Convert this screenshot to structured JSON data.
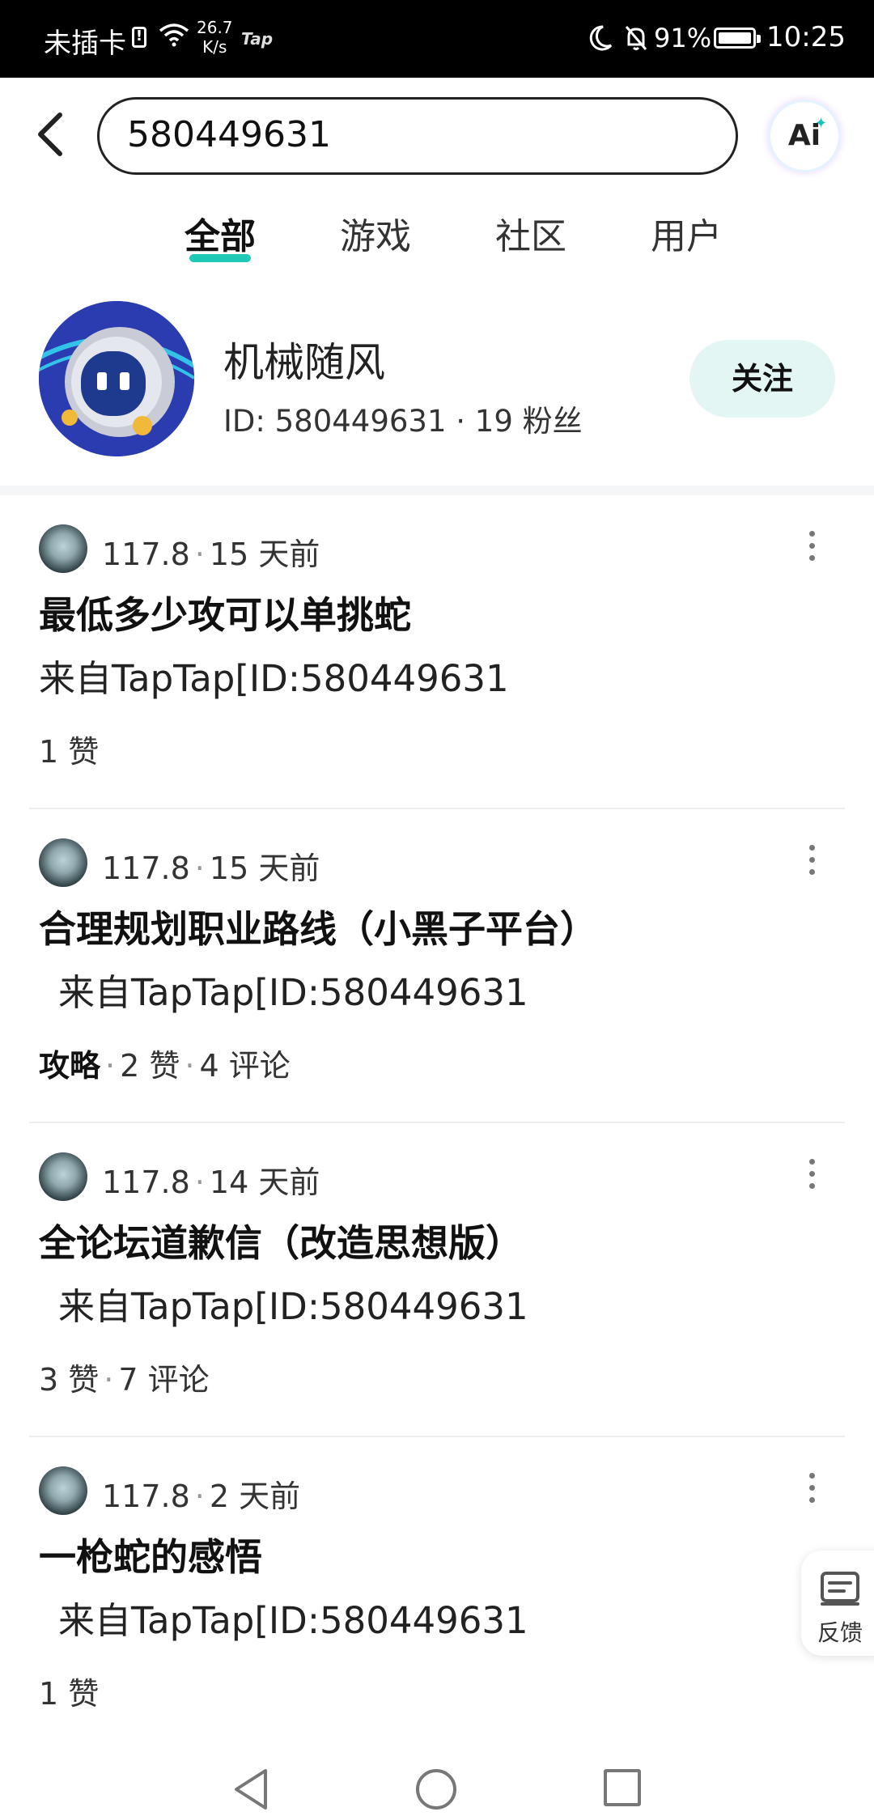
{
  "status_bar": {
    "carrier": "未插卡",
    "sim_alert": "!",
    "net_speed_value": "26.7",
    "net_speed_unit": "K/s",
    "app_badge": "Tap",
    "battery": "91%",
    "battery_level": 0.91,
    "time": "10:25"
  },
  "search": {
    "query": "580449631",
    "ai_label": "Ai"
  },
  "tabs": [
    {
      "label": "全部",
      "active": true
    },
    {
      "label": "游戏",
      "active": false
    },
    {
      "label": "社区",
      "active": false
    },
    {
      "label": "用户",
      "active": false
    }
  ],
  "user": {
    "name": "机械随风",
    "meta": "ID: 580449631 · 19 粉丝",
    "follow_label": "关注"
  },
  "posts": [
    {
      "score": "117.8",
      "time": "15 天前",
      "title": "最低多少攻可以单挑蛇",
      "snippet": "来自TapTap[ID:580449631",
      "tag": "",
      "likes": "1 赞",
      "comments": ""
    },
    {
      "score": "117.8",
      "time": "15 天前",
      "title": "合理规划职业路线（小黑子平台）",
      "snippet": "来自TapTap[ID:580449631",
      "tag": "攻略",
      "likes": "2 赞",
      "comments": "4 评论"
    },
    {
      "score": "117.8",
      "time": "14 天前",
      "title": "全论坛道歉信（改造思想版）",
      "snippet": "来自TapTap[ID:580449631",
      "tag": "",
      "likes": "3 赞",
      "comments": "7 评论"
    },
    {
      "score": "117.8",
      "time": "2 天前",
      "title": "一枪蛇的感悟",
      "snippet": "来自TapTap[ID:580449631",
      "tag": "",
      "likes": "1 赞",
      "comments": ""
    }
  ],
  "feedback": {
    "label": "反馈"
  },
  "colors": {
    "accent": "#1ec9b7",
    "follow_bg": "#e3f6f4",
    "avatar_bg": "#2b3bb0"
  }
}
